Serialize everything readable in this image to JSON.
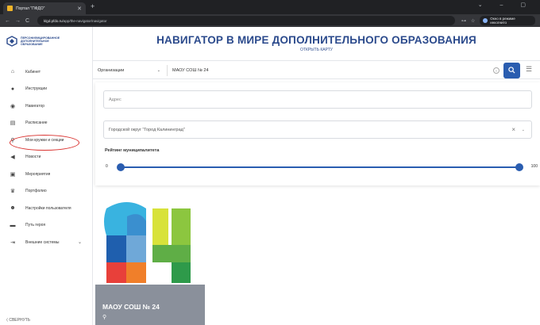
{
  "browser": {
    "tab_title": "Портал \"ПФДО\"",
    "url_host": "klgd.pfdo.ru",
    "url_path": "/app/the-navigator/navigator",
    "incognito_label": "Окно в режиме инкогнито"
  },
  "sidebar": {
    "logo_text": "ПЕРСОНИФИЦИРОВАННОЕ ДОПОЛНИТЕЛЬНОЕ ОБРАЗОВАНИЕ",
    "items": [
      {
        "label": "Кабинет",
        "icon": "home-icon"
      },
      {
        "label": "Инструкции",
        "icon": "help-icon"
      },
      {
        "label": "Навигатор",
        "icon": "compass-icon"
      },
      {
        "label": "Расписание",
        "icon": "calendar-icon"
      },
      {
        "label": "Мои кружки и секции",
        "icon": "sport-icon"
      },
      {
        "label": "Новости",
        "icon": "megaphone-icon"
      },
      {
        "label": "Мероприятия",
        "icon": "event-icon"
      },
      {
        "label": "Портфолио",
        "icon": "trophy-icon"
      },
      {
        "label": "Настройки пользователя",
        "icon": "user-settings-icon"
      },
      {
        "label": "Путь героя",
        "icon": "car-icon"
      },
      {
        "label": "Внешние системы",
        "icon": "exit-icon"
      }
    ],
    "collapse_label": "СВЕРНУТЬ"
  },
  "header": {
    "title": "НАВИГАТОР В МИРЕ ДОПОЛНИТЕЛЬНОГО ОБРАЗОВАНИЯ",
    "subtitle": "ОТКРЫТЬ КАРТУ"
  },
  "search": {
    "type_value": "Организации",
    "query": "МАОУ СОШ № 24"
  },
  "filters": {
    "address_placeholder": "Адрес",
    "district": "Городской округ \"Город Калининград\"",
    "rating_label": "Рейтинг муниципалитета",
    "rating_min": "0",
    "rating_max": "100"
  },
  "results": [
    {
      "name": "МАОУ СОШ № 24"
    }
  ],
  "colors": {
    "accent": "#2a5db0",
    "title": "#2b4a8c",
    "card_footer": "#8a909b",
    "highlight": "#d9322f"
  }
}
